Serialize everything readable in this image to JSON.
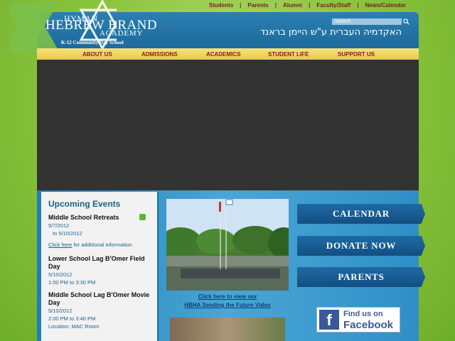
{
  "top_links": [
    "Students",
    "Parents",
    "Alumni",
    "Faculty/Staff",
    "News/Calendar"
  ],
  "logo": {
    "line1": "HYMAN",
    "line2": "HEBREW BRAND",
    "line3": "ACADEMY",
    "tagline": "K-12 Community Day School"
  },
  "search": {
    "placeholder": "Search"
  },
  "hebrew_title": "האקדמיה העברית ע\"ש היימן בראנד",
  "nav": [
    "ABOUT US",
    "ADMISSIONS",
    "ACADEMICS",
    "STUDENT LIFE",
    "SUPPORT US"
  ],
  "events": {
    "heading": "Upcoming Events",
    "items": [
      {
        "title": "Middle School Retreats",
        "date": "5/7/2012",
        "to": "to 5/10/2012",
        "link": "Click here",
        "link_tail": " for additional information"
      },
      {
        "title": "Lower School Lag B'Omer Field Day",
        "date": "5/10/2012",
        "time": "1:00 PM to 3:30 PM"
      },
      {
        "title": "Middle School Lag B'Omer Movie Day",
        "date": "5/10/2012",
        "time": "2:00 PM to 3:40 PM",
        "location": "Location: MAC Room"
      }
    ]
  },
  "video_caption": {
    "line1": "Click here to view our",
    "line2": "HBHA Seeding the Future Video"
  },
  "side_buttons": [
    "CALENDAR",
    "DONATE NOW",
    "PARENTS"
  ],
  "facebook": {
    "line1": "Find us on",
    "line2": "Facebook",
    "glyph": "f"
  },
  "colors": {
    "nav_text": "#8b1a1a",
    "header_blue": "#1e6a9c",
    "background_green": "#8cc63f"
  }
}
